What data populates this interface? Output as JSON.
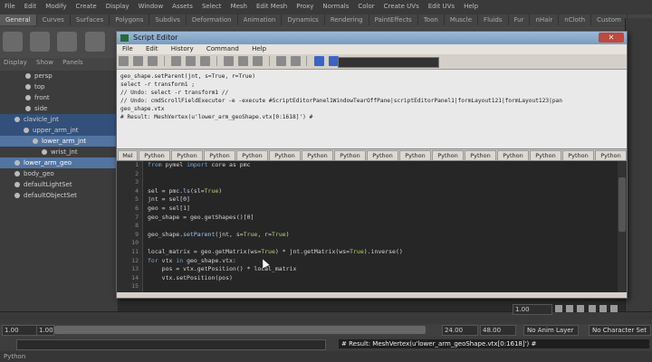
{
  "menubar": [
    "File",
    "Edit",
    "Modify",
    "Create",
    "Display",
    "Window",
    "Assets",
    "Select",
    "Mesh",
    "Edit Mesh",
    "Proxy",
    "Normals",
    "Color",
    "Create UVs",
    "Edit UVs",
    "Help"
  ],
  "shelf_tabs": [
    "General",
    "Curves",
    "Surfaces",
    "Polygons",
    "Subdivs",
    "Deformation",
    "Animation",
    "Dynamics",
    "Rendering",
    "PaintEffects",
    "Toon",
    "Muscle",
    "Fluids",
    "Fur",
    "nHair",
    "nCloth",
    "Custom",
    "TURTLE"
  ],
  "outliner": {
    "menu": [
      "Display",
      "Show",
      "Panels"
    ],
    "items": [
      {
        "label": "persp",
        "state": ""
      },
      {
        "label": "top",
        "state": ""
      },
      {
        "label": "front",
        "state": ""
      },
      {
        "label": "side",
        "state": ""
      },
      {
        "label": "clavicle_jnt",
        "state": "hl"
      },
      {
        "label": "upper_arm_jnt",
        "state": "hl"
      },
      {
        "label": "lower_arm_jnt",
        "state": "sel"
      },
      {
        "label": "wrist_jnt",
        "state": ""
      },
      {
        "label": "lower_arm_geo",
        "state": "sel"
      },
      {
        "label": "body_geo",
        "state": ""
      },
      {
        "label": "defaultLightSet",
        "state": ""
      },
      {
        "label": "defaultObjectSet",
        "state": ""
      }
    ]
  },
  "script_editor": {
    "title": "Script Editor",
    "menu": [
      "File",
      "Edit",
      "History",
      "Command",
      "Help"
    ],
    "history": [
      "geo_shape.setParent(jnt, s=True, r=True)",
      "select -r transform1 ;",
      "// Undo: select -r transform1  //",
      "// Undo: cmdScrollFieldExecuter -e -execute #ScriptEditorPanel1WindowTearOffPane|scriptEditorPanel1|formLayout121|formLayout123|pan",
      "geo_shape.vtx",
      "# Result: MeshVertex(u'lower_arm_geoShape.vtx[0:1618]') #"
    ],
    "tabs": [
      "Mel",
      "Python",
      "Python",
      "Python",
      "Python",
      "Python",
      "Python",
      "Python",
      "Python",
      "Python",
      "Python",
      "Python",
      "Python",
      "Python",
      "Python",
      "Python",
      "Python"
    ],
    "active_tab": 16,
    "line_numbers": [
      "1",
      "2",
      "3",
      "4",
      "5",
      "6",
      "7",
      "8",
      "9",
      "10",
      "11",
      "12",
      "13",
      "14",
      "15"
    ],
    "code": [
      [
        {
          "t": "from ",
          "c": "kw"
        },
        {
          "t": "pymel ",
          "c": "id"
        },
        {
          "t": "import ",
          "c": "kw"
        },
        {
          "t": "core as pmc",
          "c": "id"
        }
      ],
      [],
      [],
      [
        {
          "t": "sel = pmc.",
          "c": "id"
        },
        {
          "t": "ls",
          "c": "fn"
        },
        {
          "t": "(sl=",
          "c": "id"
        },
        {
          "t": "True",
          "c": "str"
        },
        {
          "t": ")",
          "c": "id"
        }
      ],
      [
        {
          "t": "jnt = sel[0]",
          "c": "id"
        }
      ],
      [
        {
          "t": "geo = sel[1]",
          "c": "id"
        }
      ],
      [
        {
          "t": "geo_shape = geo.getShapes()[0]",
          "c": "id"
        }
      ],
      [],
      [
        {
          "t": "geo_shape.",
          "c": "id"
        },
        {
          "t": "setParent",
          "c": "fn"
        },
        {
          "t": "(jnt, s=",
          "c": "id"
        },
        {
          "t": "True",
          "c": "str"
        },
        {
          "t": ", r=",
          "c": "id"
        },
        {
          "t": "True",
          "c": "str"
        },
        {
          "t": ")",
          "c": "id"
        }
      ],
      [],
      [
        {
          "t": "local_matrix = geo.getMatrix(ws=",
          "c": "id"
        },
        {
          "t": "True",
          "c": "str"
        },
        {
          "t": ") * jnt.getMatrix(ws=",
          "c": "id"
        },
        {
          "t": "True",
          "c": "str"
        },
        {
          "t": ").inverse()",
          "c": "id"
        }
      ],
      [
        {
          "t": "for ",
          "c": "kw"
        },
        {
          "t": "vtx ",
          "c": "id"
        },
        {
          "t": "in ",
          "c": "kw"
        },
        {
          "t": "geo_shape.vtx:",
          "c": "id"
        }
      ],
      [
        {
          "t": "    pos = vtx.getPosition() * local_matrix",
          "c": "id"
        }
      ],
      [
        {
          "t": "    vtx.setPosition(pos)",
          "c": "id"
        }
      ],
      []
    ]
  },
  "timeline": {
    "current_time": "1.00",
    "range_start": "1.00",
    "range_start2": "1.00",
    "range_end": "24.00",
    "range_end2": "48.00",
    "anim_layer": "No Anim Layer",
    "character_set": "No Character Set"
  },
  "command_line": {
    "result": "# Result: MeshVertex(u'lower_arm_geoShape.vtx[0:1618]') #"
  },
  "help_line": "Python"
}
